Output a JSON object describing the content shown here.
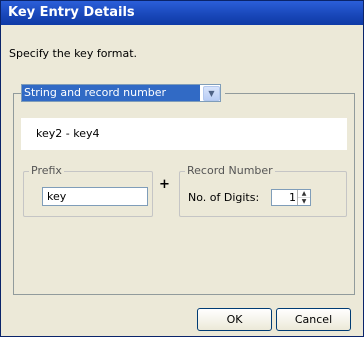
{
  "dialog": {
    "title": "Key Entry Details",
    "instruction": "Specify the key format."
  },
  "format_select": {
    "selected": "String and record number",
    "arrow_icon": "chevron-down-icon"
  },
  "preview": {
    "text": "key2 - key4"
  },
  "prefix": {
    "legend": "Prefix",
    "value": "key"
  },
  "joiner": "+",
  "record_number": {
    "legend": "Record Number",
    "digits_label": "No. of Digits:",
    "digits_value": "1"
  },
  "buttons": {
    "ok": "OK",
    "cancel": "Cancel"
  },
  "colors": {
    "title_bar": "#1846b8",
    "selection": "#316ac5",
    "dialog_bg": "#ece9d8"
  }
}
